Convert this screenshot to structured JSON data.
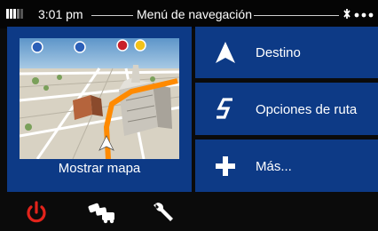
{
  "status": {
    "time": "3:01 pm",
    "title": "Menú de navegación",
    "battery_icon": "battery-icon",
    "gps_icon": "gps-signal-icon"
  },
  "map_tile": {
    "label": "Mostrar mapa",
    "preview": "3d-map-preview"
  },
  "menu": [
    {
      "label": "Destino",
      "icon": "navigation-arrow-icon"
    },
    {
      "label": "Opciones de ruta",
      "icon": "route-s-icon"
    },
    {
      "label": "Más...",
      "icon": "plus-icon"
    }
  ],
  "toolbar": [
    {
      "icon": "power-icon",
      "color": "#e3231b"
    },
    {
      "icon": "traffic-icon",
      "color": "#ffffff"
    },
    {
      "icon": "wrench-icon",
      "color": "#ffffff"
    }
  ],
  "colors": {
    "tile": "#0d3a86",
    "background": "#0b0b0b",
    "route": "#ff8a00"
  }
}
